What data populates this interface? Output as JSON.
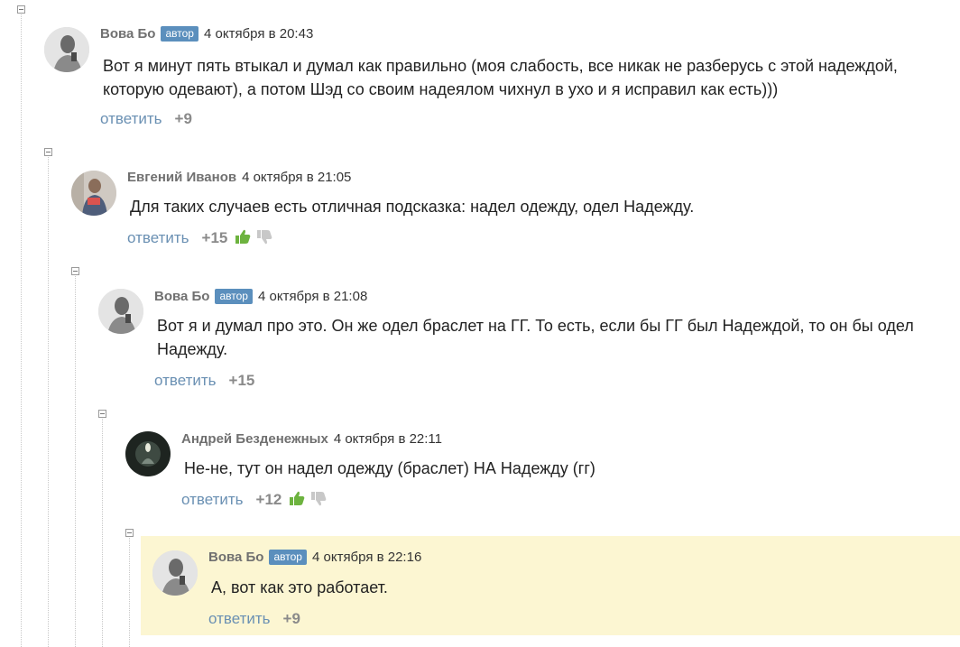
{
  "comments": [
    {
      "author": "Вова Бо",
      "badge": "автор",
      "date": "4 октября в 20:43",
      "text": "Вот я минут пять втыкал и думал как правильно (моя слабость, все никак не разберусь с этой надеждой, которую одевают), а потом Шэд со своим надеялом чихнул в ухо и я исправил как есть)))",
      "reply_label": "ответить",
      "score": "+9"
    },
    {
      "author": "Евгений Иванов",
      "date": "4 октября в 21:05",
      "text": "Для таких случаев есть отличная подсказка: надел одежду, одел Надежду.",
      "reply_label": "ответить",
      "score": "+15"
    },
    {
      "author": "Вова Бо",
      "badge": "автор",
      "date": "4 октября в 21:08",
      "text": "Вот я и думал про это. Он же одел браслет на ГГ. То есть, если бы ГГ был Надеждой, то он бы одел Надежду.",
      "reply_label": "ответить",
      "score": "+15"
    },
    {
      "author": "Андрей Безденежных",
      "date": "4 октября в 22:11",
      "text": "Не-не, тут он надел одежду (браслет) НА Надежду (гг)",
      "reply_label": "ответить",
      "score": "+12"
    },
    {
      "author": "Вова Бо",
      "badge": "автор",
      "date": "4 октября в 22:16",
      "text": "А, вот как это работает.",
      "reply_label": "ответить",
      "score": "+9"
    }
  ],
  "colors": {
    "badge": "#5b8fbd",
    "reply_link": "#6a90b3",
    "highlight": "#fcf6d2",
    "thumb_up": "#6db33f",
    "thumb_down": "#c8c8c8"
  }
}
